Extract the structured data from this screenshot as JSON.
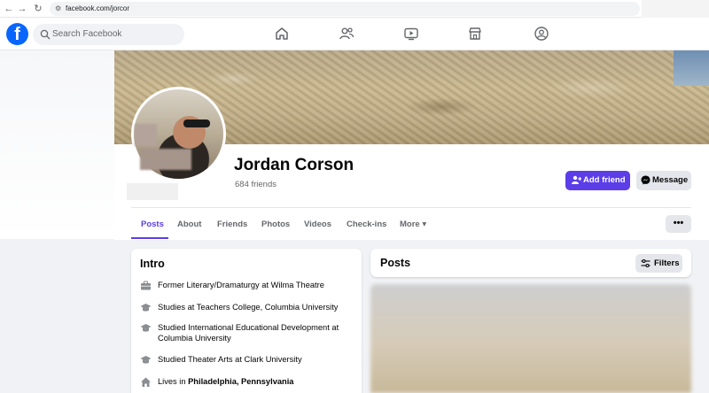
{
  "browser": {
    "url": "facebook.com/jorcor",
    "back_glyph": "←",
    "forward_glyph": "→",
    "reload_glyph": "↻"
  },
  "topbar": {
    "logo_letter": "f",
    "search_placeholder": "Search Facebook",
    "icons": [
      "home-icon",
      "friends-icon",
      "video-icon",
      "marketplace-icon",
      "groups-icon"
    ]
  },
  "profile": {
    "name": "Jordan Corson",
    "friends_count": "684 friends",
    "add_friend_label": "Add friend",
    "message_label": "Message"
  },
  "tabs": [
    {
      "label": "Posts",
      "active": true
    },
    {
      "label": "About"
    },
    {
      "label": "Friends"
    },
    {
      "label": "Photos"
    },
    {
      "label": "Videos"
    },
    {
      "label": "Check-ins"
    },
    {
      "label": "More ▾"
    }
  ],
  "more_options_label": "•••",
  "intro": {
    "title": "Intro",
    "items": [
      {
        "icon": "briefcase-icon",
        "text": "Former Literary/Dramaturgy at Wilma Theatre"
      },
      {
        "icon": "graduation-cap-icon",
        "text": "Studies at Teachers College, Columbia University"
      },
      {
        "icon": "graduation-cap-icon",
        "text": "Studied International Educational Development at Columbia University"
      },
      {
        "icon": "graduation-cap-icon",
        "text": "Studied Theater Arts at Clark University"
      },
      {
        "icon": "home-icon",
        "prefix": "Lives in ",
        "strong": "Philadelphia, Pennsylvania"
      }
    ]
  },
  "posts": {
    "title": "Posts",
    "filters_label": "Filters"
  },
  "colors": {
    "brand_blue": "#0866ff",
    "accent_purple": "#5b3ee8",
    "secondary_button": "#e4e6eb",
    "page_background": "#f0f2f5"
  }
}
